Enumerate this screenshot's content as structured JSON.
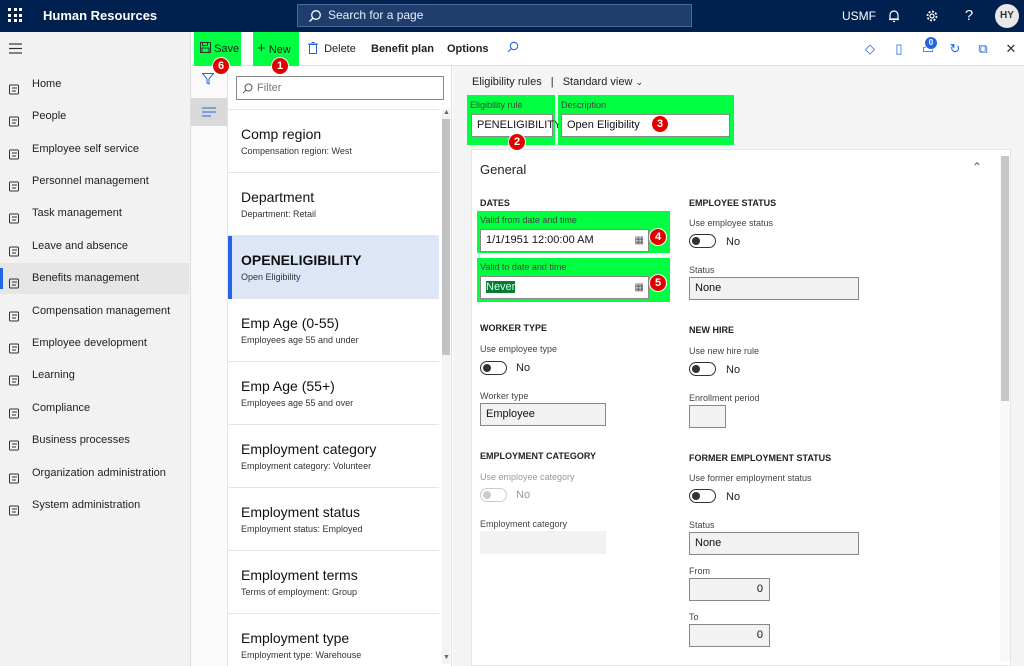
{
  "app": {
    "title": "Human Resources",
    "company": "USMF",
    "user_initials": "HY"
  },
  "search": {
    "placeholder": "Search for a page"
  },
  "nav": {
    "items": [
      {
        "label": "Home",
        "icon": "home-icon"
      },
      {
        "label": "People",
        "icon": "people-icon"
      },
      {
        "label": "Employee self service",
        "icon": "self-service-icon"
      },
      {
        "label": "Personnel management",
        "icon": "personnel-icon"
      },
      {
        "label": "Task management",
        "icon": "task-icon"
      },
      {
        "label": "Leave and absence",
        "icon": "leave-icon"
      },
      {
        "label": "Benefits management",
        "icon": "benefits-icon",
        "active": true
      },
      {
        "label": "Compensation management",
        "icon": "compensation-icon"
      },
      {
        "label": "Employee development",
        "icon": "development-icon"
      },
      {
        "label": "Learning",
        "icon": "learning-icon"
      },
      {
        "label": "Compliance",
        "icon": "compliance-icon"
      },
      {
        "label": "Business processes",
        "icon": "business-process-icon"
      },
      {
        "label": "Organization administration",
        "icon": "org-admin-icon"
      },
      {
        "label": "System administration",
        "icon": "system-admin-icon"
      }
    ]
  },
  "toolbar": {
    "save_label": "Save",
    "new_label": "New",
    "delete_label": "Delete",
    "benefit_plan_label": "Benefit plan",
    "options_label": "Options",
    "notification_count": "0"
  },
  "annotations": [
    "1",
    "2",
    "3",
    "4",
    "5",
    "6"
  ],
  "list": {
    "filter_placeholder": "Filter",
    "items": [
      {
        "title": "Comp region",
        "subtitle": "Compensation region:  West"
      },
      {
        "title": "Department",
        "subtitle": "Department:  Retail"
      },
      {
        "title": "OPENELIGIBILITY",
        "subtitle": "Open Eligibility",
        "selected": true
      },
      {
        "title": "Emp Age (0-55)",
        "subtitle": "Employees age 55 and under"
      },
      {
        "title": "Emp Age (55+)",
        "subtitle": "Employees age 55 and over"
      },
      {
        "title": "Employment category",
        "subtitle": "Employment category:  Volunteer"
      },
      {
        "title": "Employment status",
        "subtitle": "Employment status: Employed"
      },
      {
        "title": "Employment terms",
        "subtitle": "Terms of employment: Group"
      },
      {
        "title": "Employment type",
        "subtitle": "Employment type: Warehouse"
      }
    ]
  },
  "detail": {
    "breadcrumb": "Eligibility rules",
    "separator": "|",
    "view": "Standard view",
    "eligibility_rule_label": "Eligibility rule",
    "eligibility_rule_value": "PENELIGIBILITY",
    "description_label": "Description",
    "description_value": "Open Eligibility",
    "general": {
      "header": "General",
      "dates_header": "DATES",
      "valid_from_label": "Valid from date and time",
      "valid_from_value": "1/1/1951 12:00:00 AM",
      "valid_to_label": "Valid to date and time",
      "valid_to_value": "Never",
      "worker_type_header": "WORKER TYPE",
      "use_employee_type_label": "Use employee type",
      "use_employee_type_value": "No",
      "worker_type_label": "Worker type",
      "worker_type_value": "Employee",
      "employment_category_header": "EMPLOYMENT CATEGORY",
      "use_employee_category_label": "Use employee category",
      "use_employee_category_value": "No",
      "employment_category_label": "Employment category",
      "employee_status_header": "EMPLOYEE STATUS",
      "use_employee_status_label": "Use employee status",
      "use_employee_status_value": "No",
      "status_label": "Status",
      "status_value": "None",
      "new_hire_header": "NEW HIRE",
      "use_new_hire_label": "Use new hire rule",
      "use_new_hire_value": "No",
      "enrollment_period_label": "Enrollment period",
      "former_status_header": "FORMER EMPLOYMENT STATUS",
      "use_former_status_label": "Use former employment status",
      "use_former_status_value": "No",
      "former_status_label": "Status",
      "former_status_value": "None",
      "from_label": "From",
      "from_value": "0",
      "to_label": "To",
      "to_value": "0"
    }
  },
  "colors": {
    "highlight": "#00ff40",
    "brand": "#002050",
    "accent": "#2266e3",
    "badge": "#e00000"
  }
}
